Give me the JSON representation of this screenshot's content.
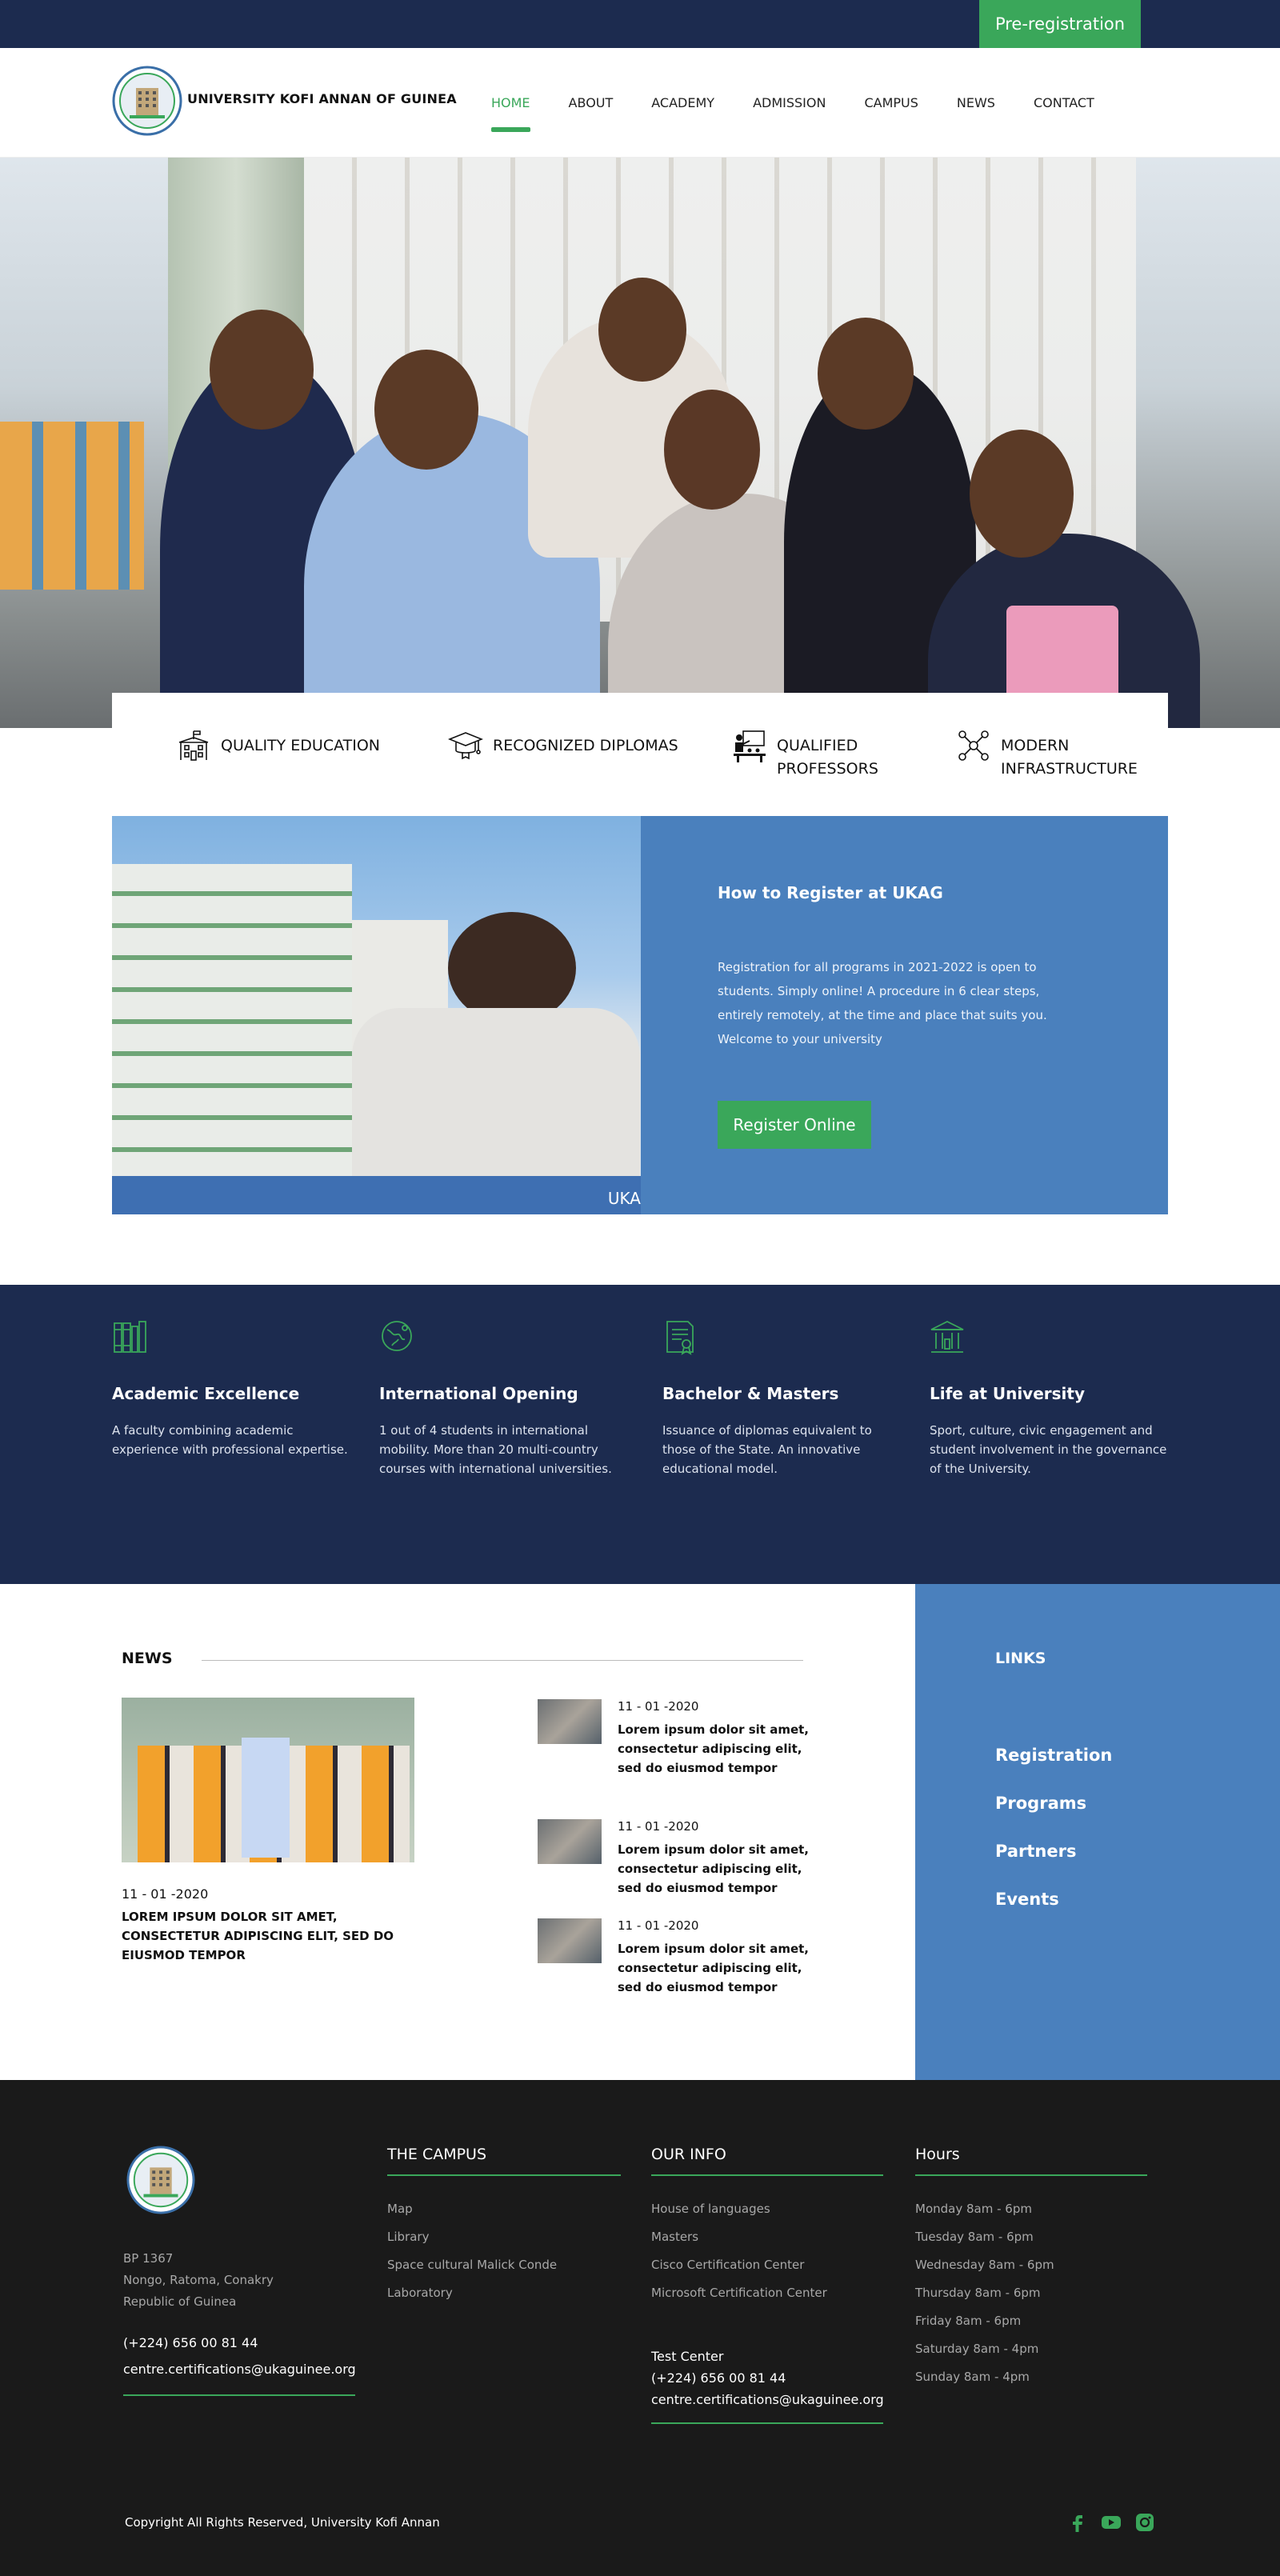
{
  "topbar": {
    "prereg_label": "Pre-registration"
  },
  "header": {
    "brand": "UNIVERSITY KOFI ANNAN OF GUINEA",
    "nav": [
      "HOME",
      "ABOUT",
      "ACADEMY",
      "ADMISSION",
      "CAMPUS",
      "NEWS",
      "CONTACT"
    ]
  },
  "features": [
    {
      "label": "QUALITY EDUCATION",
      "icon": "school-building-icon"
    },
    {
      "label": "RECOGNIZED DIPLOMAS",
      "icon": "graduation-cap-icon"
    },
    {
      "label": "QUALIFIED PROFESSORS",
      "icon": "teacher-board-icon"
    },
    {
      "label": "MODERN INFRASTRUCTURE",
      "icon": "network-nodes-icon"
    }
  ],
  "register": {
    "title": "How to Register at UKAG",
    "text": "Registration for all programs in 2021-2022 is open to students. Simply online! A procedure in 6 clear steps, entirely remotely, at the time and place that suits you. Welcome to your university",
    "button": "Register Online",
    "photo_tag": "UKA"
  },
  "values": [
    {
      "title": "Academic Excellence",
      "text": "A faculty combining academic experience with professional expertise.",
      "icon": "books-icon"
    },
    {
      "title": "International Opening",
      "text": "1 out of 4 students in international mobility. More than 20 multi-country courses with international universities.",
      "icon": "globe-icon"
    },
    {
      "title": "Bachelor & Masters",
      "text": "Issuance of diplomas equivalent to those of the State. An innovative educational model.",
      "icon": "diploma-icon"
    },
    {
      "title": "Life at University",
      "text": "Sport, culture, civic engagement and student involvement in the governance of the University.",
      "icon": "university-building-icon"
    }
  ],
  "news": {
    "title": "NEWS",
    "main": {
      "date": "11 - 01 -2020",
      "headline": "LOREM IPSUM DOLOR SIT AMET, CONSECTETUR ADIPISCING ELIT, SED DO EIUSMOD TEMPOR"
    },
    "side": [
      {
        "date": "11 - 01 -2020",
        "headline": "Lorem ipsum dolor sit amet, consectetur adipiscing elit, sed do eiusmod tempor"
      },
      {
        "date": "11 - 01 -2020",
        "headline": "Lorem ipsum dolor sit amet, consectetur adipiscing elit, sed do eiusmod tempor"
      },
      {
        "date": "11 - 01 -2020",
        "headline": "Lorem ipsum dolor sit amet, consectetur adipiscing elit, sed do eiusmod tempor"
      }
    ]
  },
  "links": {
    "title": "LINKS",
    "items": [
      "Registration",
      "Programs",
      "Partners",
      "Events"
    ]
  },
  "footer": {
    "address": [
      "BP 1367",
      "Nongo, Ratoma, Conakry",
      "Republic of Guinea"
    ],
    "phone": "(+224) 656 00 81 44",
    "email": "centre.certifications@ukaguinee.org",
    "campus": {
      "title": "THE CAMPUS",
      "items": [
        "Map",
        "Library",
        "Space cultural Malick Conde",
        "Laboratory"
      ]
    },
    "info": {
      "title": "OUR INFO",
      "items": [
        "House of languages",
        "Masters",
        "Cisco Certification Center",
        "Microsoft Certification Center"
      ]
    },
    "test": {
      "label": "Test Center",
      "phone": "(+224) 656 00 81 44",
      "email": "centre.certifications@ukaguinee.org"
    },
    "hours": {
      "title": "Hours",
      "items": [
        "Monday 8am - 6pm",
        "Tuesday 8am - 6pm",
        "Wednesday 8am - 6pm",
        "Thursday 8am - 6pm",
        "Friday 8am - 6pm",
        "Saturday 8am - 4pm",
        "Sunday 8am - 4pm"
      ]
    },
    "copyright": "Copyright All Rights Reserved, University Kofi Annan",
    "social": [
      "facebook-icon",
      "youtube-icon",
      "instagram-icon"
    ]
  },
  "colors": {
    "navy": "#1c2b4f",
    "green": "#3aa75a",
    "blue": "#4a80bd",
    "footer": "#1a1a1a"
  }
}
